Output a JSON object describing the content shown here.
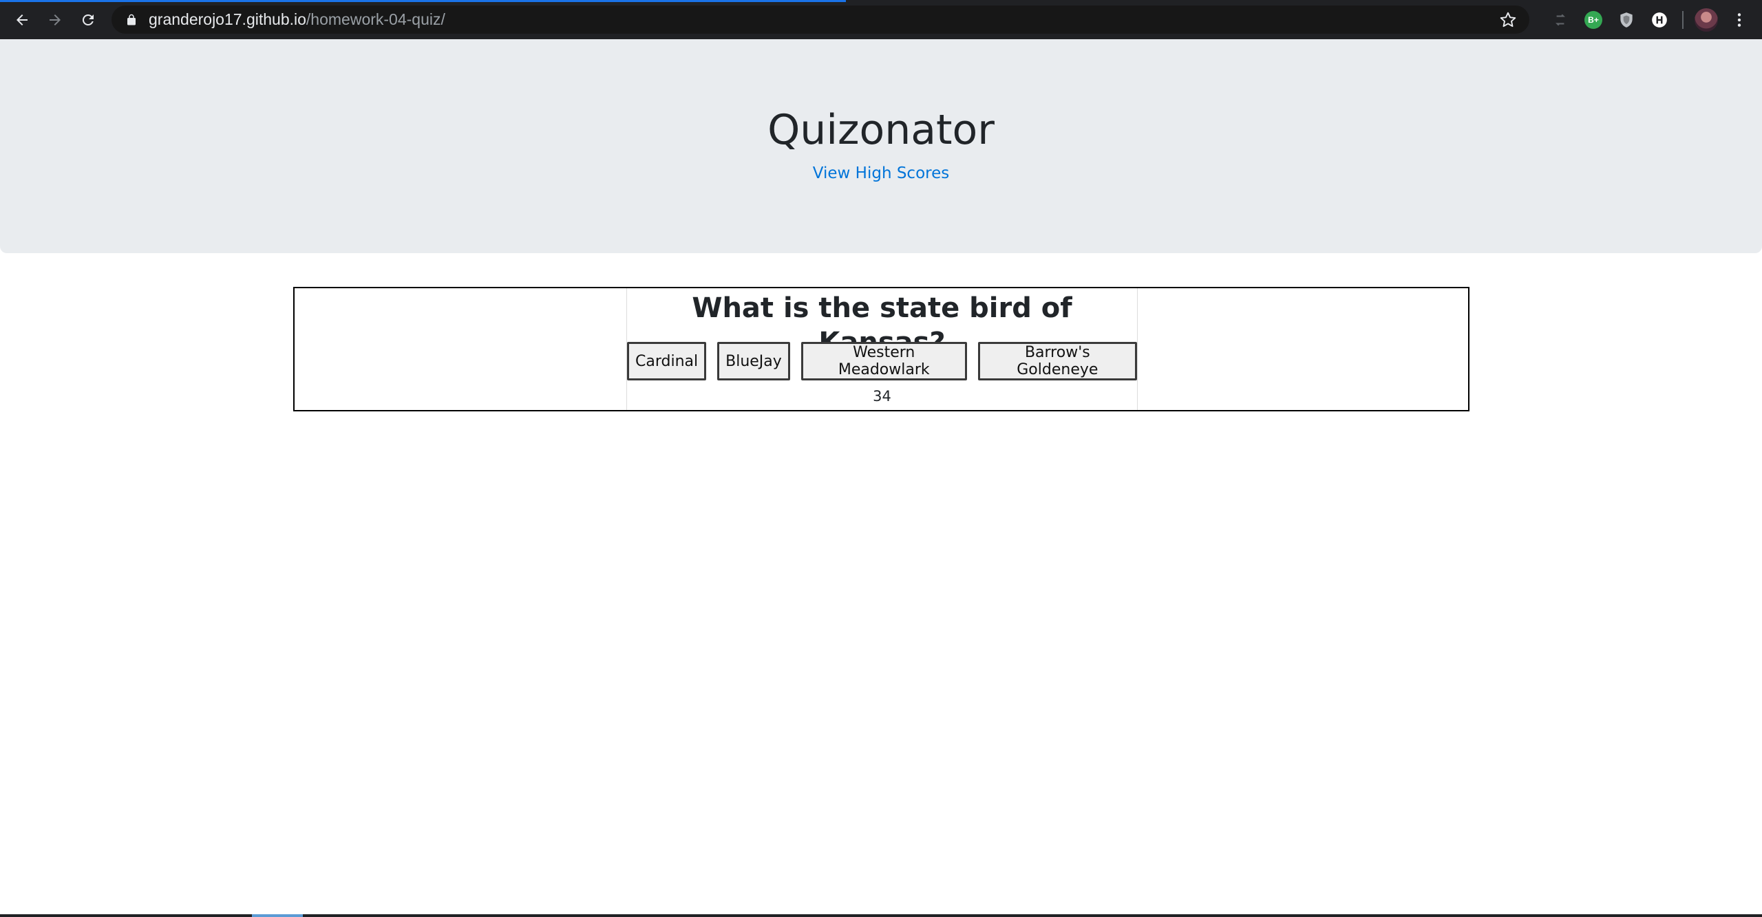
{
  "browser": {
    "url_host": "granderojo17.github.io",
    "url_path": "/homework-04-quiz/",
    "load_progress": 0.48,
    "extension_badge": "B+",
    "colors": {
      "chrome": "#202124",
      "omnibox": "#171717",
      "progress": "#1a73e8"
    }
  },
  "header": {
    "title": "Quizonator",
    "high_scores_label": "View High Scores",
    "colors": {
      "background": "#e9ecef",
      "link": "#0074d9"
    }
  },
  "quiz": {
    "question": "What is the state bird of Kansas?",
    "answers": [
      "Cardinal",
      "BlueJay",
      "Western Meadowlark",
      "Barrow's Goldeneye"
    ],
    "timer": "34"
  }
}
